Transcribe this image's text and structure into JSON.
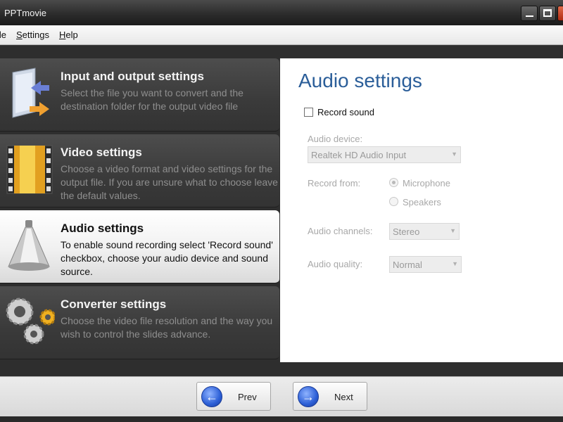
{
  "window": {
    "title": "PPTmovie"
  },
  "menu": {
    "items": [
      {
        "label": "File",
        "underline": "F"
      },
      {
        "label": "Settings",
        "underline": "S"
      },
      {
        "label": "Help",
        "underline": "H"
      }
    ]
  },
  "steps": [
    {
      "title": "Input and output settings",
      "desc": "Select the file you want to convert and the destination folder for the output video file",
      "icon": "folder-arrows-icon",
      "active": false
    },
    {
      "title": "Video settings",
      "desc": "Choose a video format and video settings for the output file. If you are unsure what to choose leave the default values.",
      "icon": "film-strip-icon",
      "active": false
    },
    {
      "title": "Audio settings",
      "desc": "To enable sound recording select 'Record sound' checkbox, choose your audio device and sound source.",
      "icon": "megaphone-icon",
      "active": true
    },
    {
      "title": "Converter settings",
      "desc": "Choose the video file resolution and the way you wish to control the slides advance.",
      "icon": "gears-icon",
      "active": false
    }
  ],
  "audio_panel": {
    "title": "Audio settings",
    "record_sound_label": "Record sound",
    "record_sound_checked": false,
    "audio_device_label": "Audio device:",
    "audio_device_value": "Realtek HD Audio Input",
    "record_from_label": "Record from:",
    "record_from_options": [
      {
        "label": "Microphone",
        "selected": true
      },
      {
        "label": "Speakers",
        "selected": false
      }
    ],
    "audio_channels_label": "Audio channels:",
    "audio_channels_value": "Stereo",
    "audio_quality_label": "Audio quality:",
    "audio_quality_value": "Normal"
  },
  "nav": {
    "prev_label": "Prev",
    "next_label": "Next"
  },
  "colors": {
    "panel_title": "#2b5e99",
    "dark_bg": "#2e2e2e",
    "disabled_text": "#a8a8a8"
  }
}
